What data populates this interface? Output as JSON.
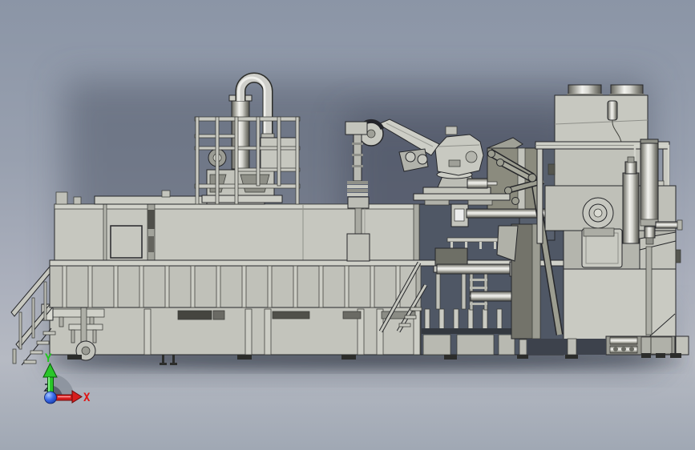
{
  "triad": {
    "x_label": "X",
    "y_label": "Y",
    "x_axis_color": "#e11414",
    "y_axis_color": "#1fc41f",
    "origin_ball_color": "#2b50d4",
    "rotation_arc_color": "#8a909b"
  },
  "colors": {
    "background_top": "#8b95a6",
    "background_mid": "#a9aebb",
    "background_light": "#b6bac3",
    "background_bottom": "#a0a8b4",
    "machine_light": "#c7c8c0",
    "machine_mid": "#b3b4ac",
    "olive_panel": "#8b8b7e",
    "olive_dark": "#73736a",
    "interior_shadow": "#4f5765",
    "outline": "#26272a",
    "metal_highlight": "#f2f2ee"
  }
}
